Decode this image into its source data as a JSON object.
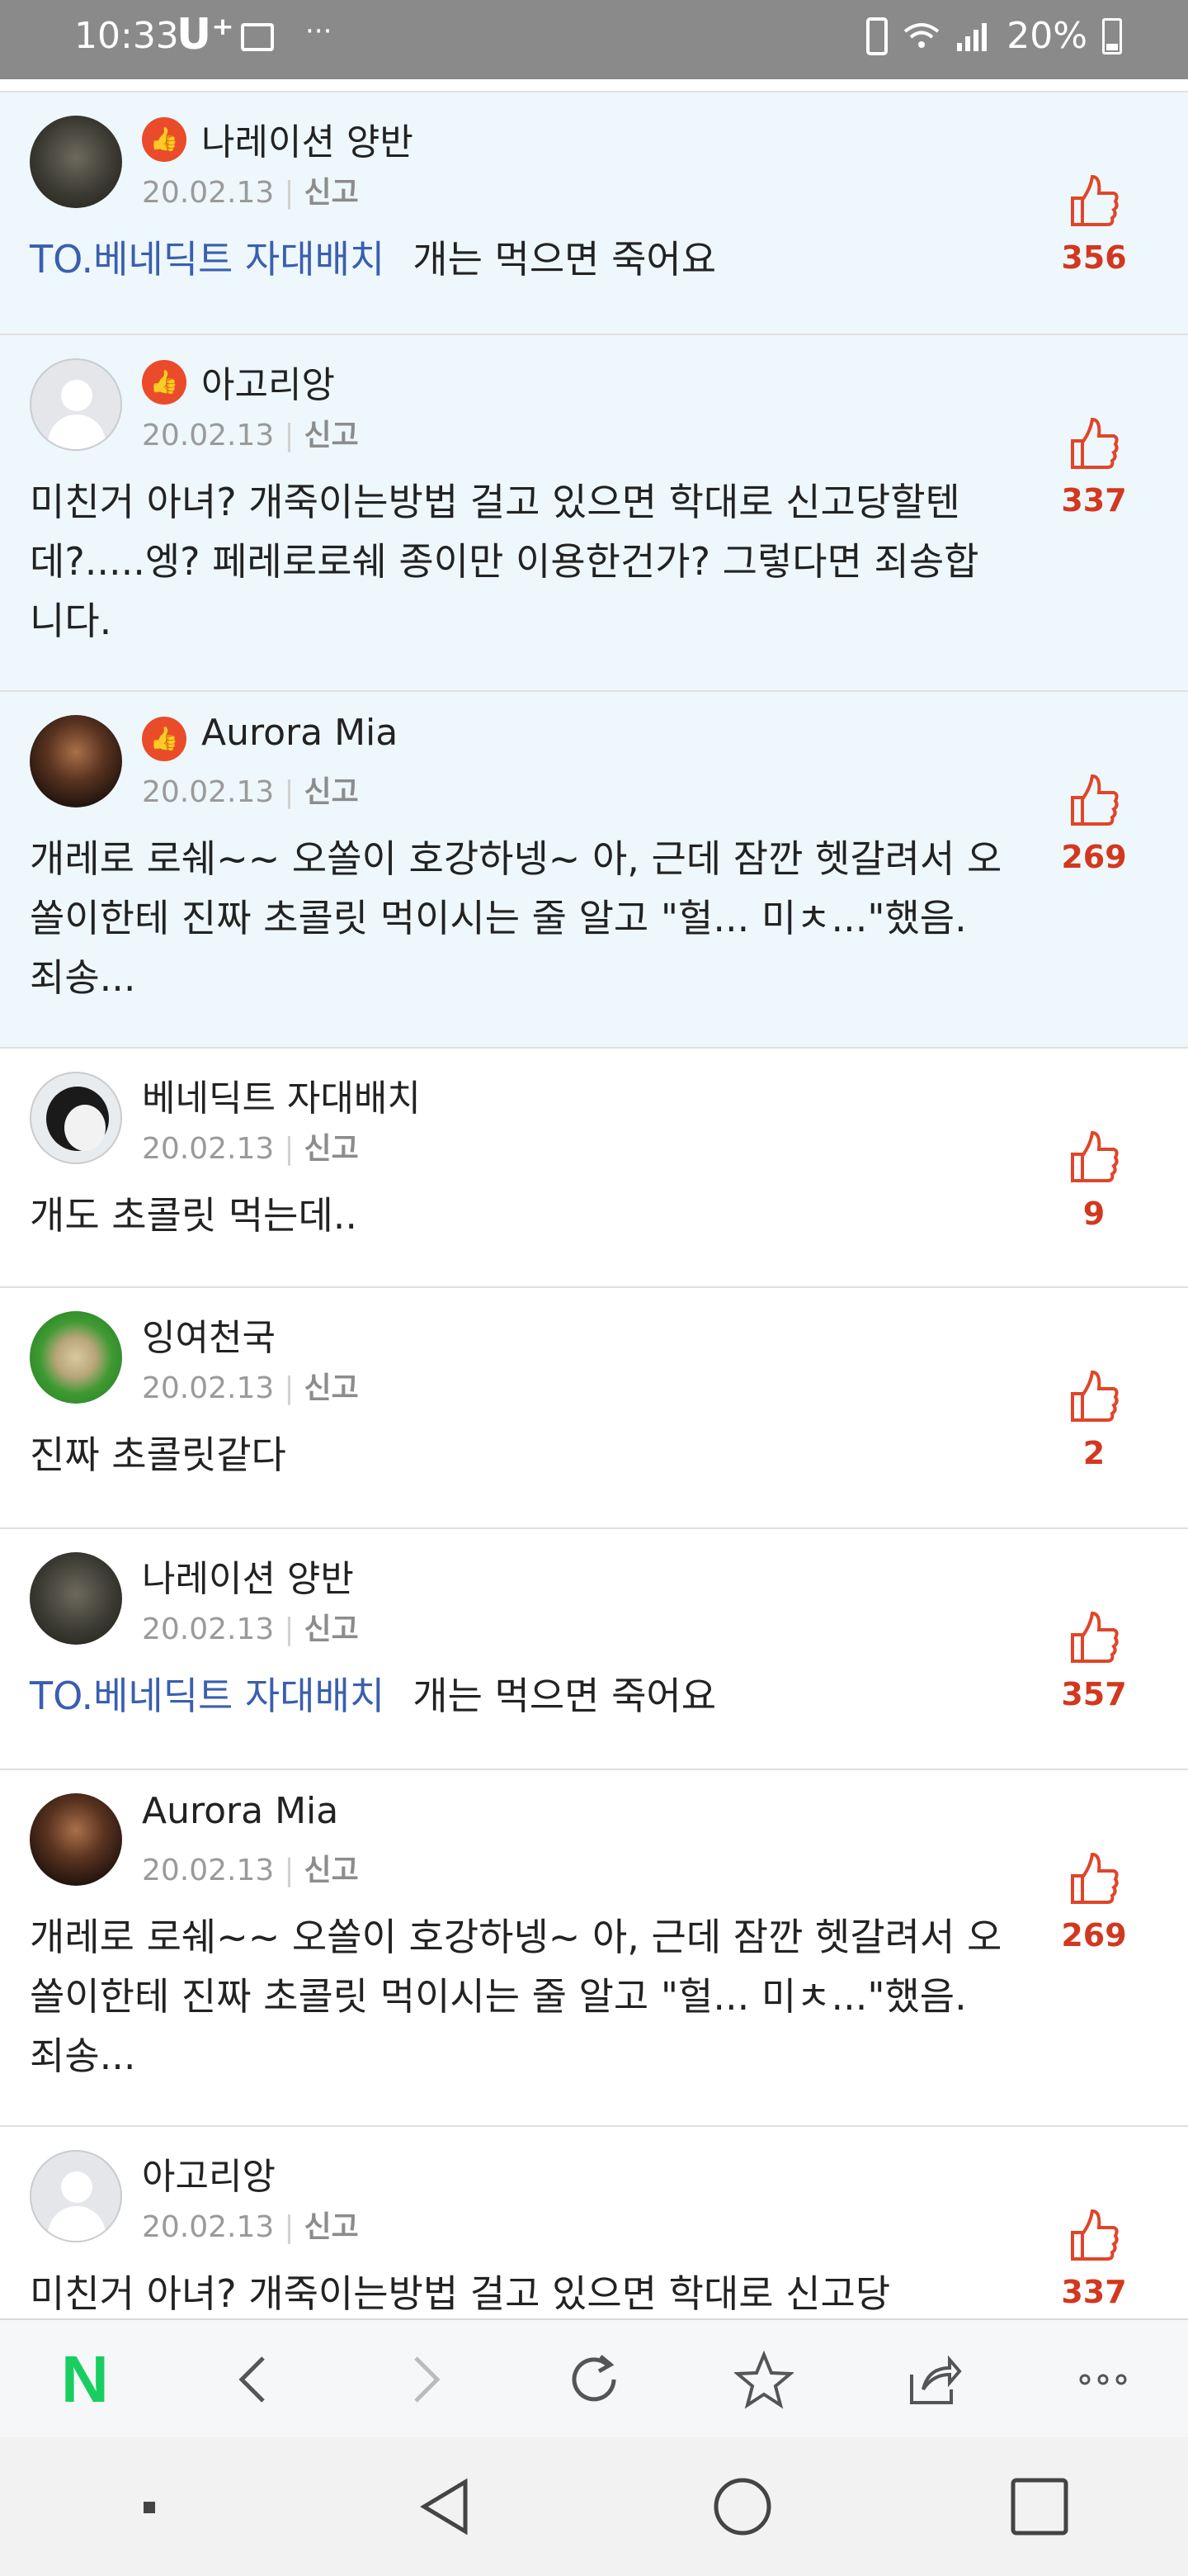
{
  "status_bar": {
    "time": "10:33",
    "carrier": "U⁺",
    "dots": "···",
    "battery": "20%"
  },
  "comments": [
    {
      "name": "나레이션 양반",
      "date": "20.02.13",
      "report": "신고",
      "to": "TO.베네딕트 자대배치",
      "text": "개는 먹으면 죽어요",
      "likes": "356",
      "best": true,
      "avatar": "dark"
    },
    {
      "name": "아고리앙",
      "date": "20.02.13",
      "report": "신고",
      "to": "",
      "text": "미친거 아녀? 개죽이는방법 걸고 있으면 학대로 신고당할텐데?.....엥? 페레로로쉐 종이만 이용한건가? 그렇다면 죄송합니다.",
      "likes": "337",
      "best": true,
      "avatar": "grey"
    },
    {
      "name": "Aurora Mia",
      "date": "20.02.13",
      "report": "신고",
      "to": "",
      "text": "개레로 로쉐~~ 오쏠이 호강하넹~ 아, 근데 잠깐 헷갈려서 오쏠이한테 진짜 초콜릿 먹이시는 줄 알고 \"헐... 미ㅊ...\"했음. 죄송...",
      "likes": "269",
      "best": true,
      "avatar": "portrait"
    },
    {
      "name": "베네딕트 자대배치",
      "date": "20.02.13",
      "report": "신고",
      "to": "",
      "text": "개도 초콜릿 먹는데..",
      "likes": "9",
      "best": false,
      "avatar": "penguin"
    },
    {
      "name": "잉여천국",
      "date": "20.02.13",
      "report": "신고",
      "to": "",
      "text": "진짜 초콜릿같다",
      "likes": "2",
      "best": false,
      "avatar": "field"
    },
    {
      "name": "나레이션 양반",
      "date": "20.02.13",
      "report": "신고",
      "to": "TO.베네딕트 자대배치",
      "text": "개는 먹으면 죽어요",
      "likes": "357",
      "best": false,
      "avatar": "dark"
    },
    {
      "name": "Aurora Mia",
      "date": "20.02.13",
      "report": "신고",
      "to": "",
      "text": "개레로 로쉐~~ 오쏠이 호강하넹~ 아, 근데 잠깐 헷갈려서 오쏠이한테 진짜 초콜릿 먹이시는 줄 알고 \"헐... 미ㅊ...\"했음. 죄송...",
      "likes": "269",
      "best": false,
      "avatar": "portrait"
    },
    {
      "name": "아고리앙",
      "date": "20.02.13",
      "report": "신고",
      "to": "",
      "text": "미친거 아녀? 개죽이는방법 걸고 있으면 학대로 신고당",
      "likes": "337",
      "best": false,
      "avatar": "grey"
    }
  ],
  "toolbar": {
    "logo": "N",
    "items": [
      "naver-home",
      "back",
      "forward",
      "refresh",
      "bookmark",
      "share",
      "more"
    ]
  },
  "navbar": {
    "items": [
      "recents-dot",
      "back",
      "home",
      "overview"
    ]
  },
  "colors": {
    "best_background": "#eef7fb",
    "like_red": "#d2381f",
    "to_blue": "#3a5fb0",
    "naver_green": "#19ce60"
  }
}
